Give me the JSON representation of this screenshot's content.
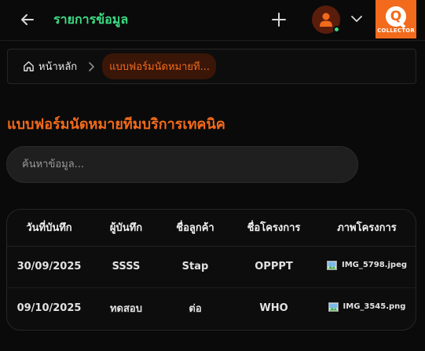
{
  "header": {
    "title": "รายการข้อมูล",
    "brand": {
      "letter": "Q",
      "text": "COLLECTOR",
      "color": "#f26a1b"
    },
    "icons": {
      "back": "arrow-left-icon",
      "add": "plus-icon",
      "user": "user-icon",
      "menu": "chevron-down-icon"
    }
  },
  "breadcrumb": {
    "home_label": "หน้าหลัก",
    "current_label": "แบบฟอร์มนัดหมายที..."
  },
  "page": {
    "title": "แบบฟอร์มนัดหมายทีมบริการเทคนิค"
  },
  "search": {
    "value": "",
    "placeholder": "ค้นหาข้อมูล..."
  },
  "table": {
    "columns": [
      "วันที่บันทึก",
      "ผู้บันทึก",
      "ชื่อลูกค้า",
      "ชื่อโครงการ",
      "ภาพโครงการ"
    ],
    "rows": [
      {
        "date": "30/09/2025",
        "recorder": "SSSS",
        "customer": "Stap",
        "project": "OPPPT",
        "image": "IMG_5798.jpeg"
      },
      {
        "date": "09/10/2025",
        "recorder": "ทดสอบ",
        "customer": "ต่อ",
        "project": "WHO",
        "image": "IMG_3545.png"
      }
    ]
  },
  "colors": {
    "accent": "#f26a1b",
    "title_green": "#3ddc84",
    "background": "#0a0a0a"
  }
}
